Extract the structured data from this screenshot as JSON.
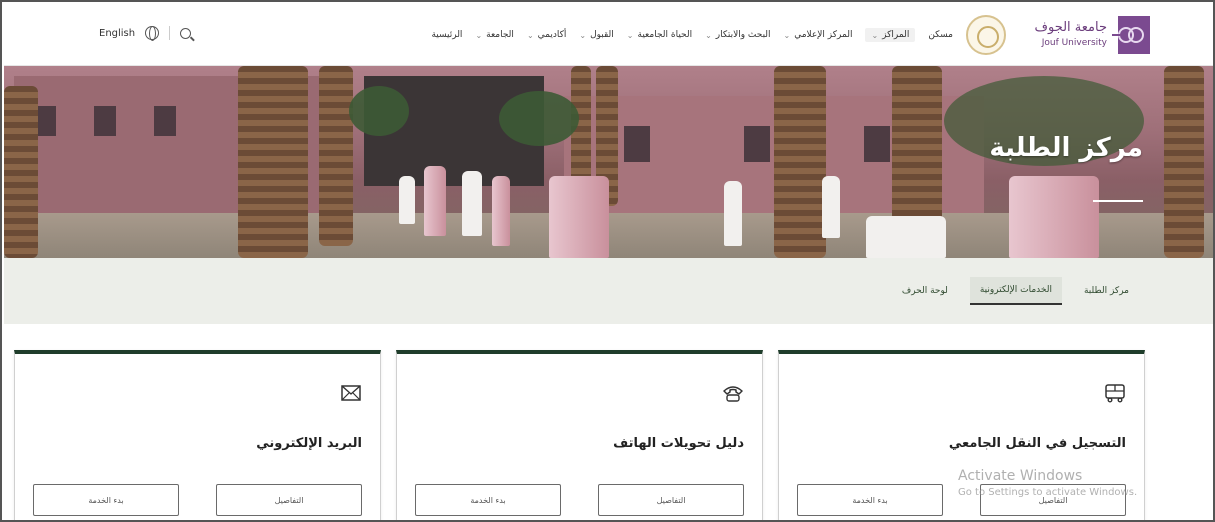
{
  "header": {
    "logo_ar": "جامعة الجوف",
    "logo_en": "Jouf University",
    "nav": [
      {
        "label": "الرئيسية",
        "dropdown": false
      },
      {
        "label": "الجامعة",
        "dropdown": true
      },
      {
        "label": "أكاديمي",
        "dropdown": true
      },
      {
        "label": "القبول",
        "dropdown": true
      },
      {
        "label": "الحياة الجامعية",
        "dropdown": true
      },
      {
        "label": "البحث والابتكار",
        "dropdown": true
      },
      {
        "label": "المركز الإعلامي",
        "dropdown": true
      },
      {
        "label": "المراكز",
        "dropdown": true,
        "active": true
      },
      {
        "label": "مسكن",
        "dropdown": false
      }
    ],
    "language_label": "English",
    "icons": [
      "globe-icon",
      "search-icon"
    ]
  },
  "hero": {
    "title": "مركز الطلبة"
  },
  "tabs": [
    {
      "label": "مركز الطلبة",
      "active": false
    },
    {
      "label": "الخدمات الإلكترونية",
      "active": true
    },
    {
      "label": "لوحة الحرف",
      "active": false
    }
  ],
  "cards": [
    {
      "title": "التسجيل في النقل الجامعي",
      "icon": "bus-icon",
      "details_label": "التفاصيل",
      "request_label": "بدء الخدمة"
    },
    {
      "title": "دليل تحويلات الهاتف",
      "icon": "phone-icon",
      "details_label": "التفاصيل",
      "request_label": "بدء الخدمة"
    },
    {
      "title": "البريد الإلكتروني",
      "icon": "mail-icon",
      "details_label": "التفاصيل",
      "request_label": "بدء الخدمة"
    }
  ],
  "watermark": {
    "line1": "Activate Windows",
    "line2": "Go to Settings to activate Windows."
  },
  "colors": {
    "accent_dark_green": "#1f3d2b",
    "side_tab_green": "#2e6b3c",
    "brand_purple": "#6b3d7c",
    "band_bg": "#eceee9"
  }
}
